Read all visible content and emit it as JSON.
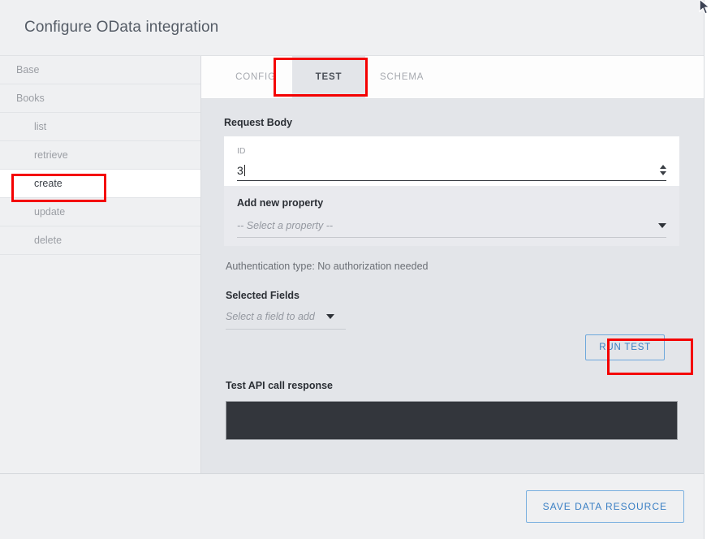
{
  "window": {
    "title": "Configure OData integration",
    "cursor_icon": "mouse-pointer-icon"
  },
  "sidebar": {
    "items": [
      {
        "label": "Base",
        "indent": false,
        "selected": false
      },
      {
        "label": "Books",
        "indent": false,
        "selected": false
      },
      {
        "label": "list",
        "indent": true,
        "selected": false
      },
      {
        "label": "retrieve",
        "indent": true,
        "selected": false
      },
      {
        "label": "create",
        "indent": true,
        "selected": true
      },
      {
        "label": "update",
        "indent": true,
        "selected": false
      },
      {
        "label": "delete",
        "indent": true,
        "selected": false
      }
    ]
  },
  "tabs": [
    {
      "label": "CONFIG",
      "active": false
    },
    {
      "label": "TEST",
      "active": true
    },
    {
      "label": "SCHEMA",
      "active": false
    }
  ],
  "test_panel": {
    "request_body_label": "Request Body",
    "id_field": {
      "label": "ID",
      "value": "3",
      "spinner_up_icon": "caret-up-icon",
      "spinner_down_icon": "caret-down-icon"
    },
    "add_property": {
      "title": "Add new property",
      "placeholder": "-- Select a property --",
      "chevron_icon": "chevron-down-icon"
    },
    "auth_line": "Authentication type: No authorization needed",
    "selected_fields": {
      "title": "Selected Fields",
      "placeholder": "Select a field to add",
      "chevron_icon": "chevron-down-icon"
    },
    "run_test_label": "RUN TEST",
    "response_label": "Test API call response",
    "response_text": ""
  },
  "footer": {
    "save_label": "SAVE DATA RESOURCE"
  },
  "annotations": {
    "accent_color": "#f40000",
    "boxes": [
      {
        "name": "create-sidebar-item"
      },
      {
        "name": "test-tab"
      },
      {
        "name": "run-test-button"
      }
    ]
  },
  "colors": {
    "dialog_bg": "#e3e5e9",
    "header_bg": "#eff0f2",
    "sidebar_bg": "#eff0f2",
    "active_tab_bg": "#e3e5e9",
    "link_blue": "#3a7fc4",
    "response_box": "#33363c"
  }
}
